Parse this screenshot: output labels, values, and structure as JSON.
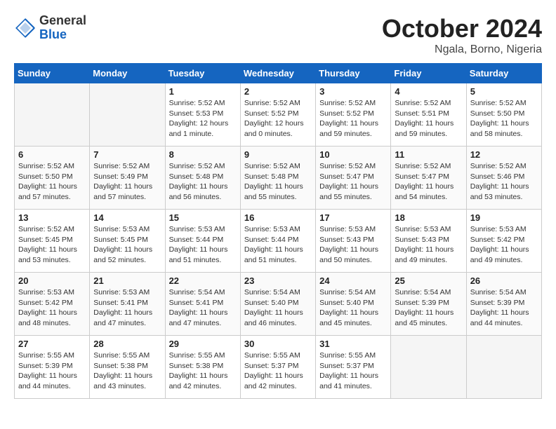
{
  "header": {
    "logo_general": "General",
    "logo_blue": "Blue",
    "month_title": "October 2024",
    "location": "Ngala, Borno, Nigeria"
  },
  "columns": [
    "Sunday",
    "Monday",
    "Tuesday",
    "Wednesday",
    "Thursday",
    "Friday",
    "Saturday"
  ],
  "weeks": [
    [
      {
        "day": "",
        "info": "",
        "empty": true
      },
      {
        "day": "",
        "info": "",
        "empty": true
      },
      {
        "day": "1",
        "info": "Sunrise: 5:52 AM\nSunset: 5:53 PM\nDaylight: 12 hours\nand 1 minute.",
        "empty": false
      },
      {
        "day": "2",
        "info": "Sunrise: 5:52 AM\nSunset: 5:52 PM\nDaylight: 12 hours\nand 0 minutes.",
        "empty": false
      },
      {
        "day": "3",
        "info": "Sunrise: 5:52 AM\nSunset: 5:52 PM\nDaylight: 11 hours\nand 59 minutes.",
        "empty": false
      },
      {
        "day": "4",
        "info": "Sunrise: 5:52 AM\nSunset: 5:51 PM\nDaylight: 11 hours\nand 59 minutes.",
        "empty": false
      },
      {
        "day": "5",
        "info": "Sunrise: 5:52 AM\nSunset: 5:50 PM\nDaylight: 11 hours\nand 58 minutes.",
        "empty": false
      }
    ],
    [
      {
        "day": "6",
        "info": "Sunrise: 5:52 AM\nSunset: 5:50 PM\nDaylight: 11 hours\nand 57 minutes.",
        "empty": false
      },
      {
        "day": "7",
        "info": "Sunrise: 5:52 AM\nSunset: 5:49 PM\nDaylight: 11 hours\nand 57 minutes.",
        "empty": false
      },
      {
        "day": "8",
        "info": "Sunrise: 5:52 AM\nSunset: 5:48 PM\nDaylight: 11 hours\nand 56 minutes.",
        "empty": false
      },
      {
        "day": "9",
        "info": "Sunrise: 5:52 AM\nSunset: 5:48 PM\nDaylight: 11 hours\nand 55 minutes.",
        "empty": false
      },
      {
        "day": "10",
        "info": "Sunrise: 5:52 AM\nSunset: 5:47 PM\nDaylight: 11 hours\nand 55 minutes.",
        "empty": false
      },
      {
        "day": "11",
        "info": "Sunrise: 5:52 AM\nSunset: 5:47 PM\nDaylight: 11 hours\nand 54 minutes.",
        "empty": false
      },
      {
        "day": "12",
        "info": "Sunrise: 5:52 AM\nSunset: 5:46 PM\nDaylight: 11 hours\nand 53 minutes.",
        "empty": false
      }
    ],
    [
      {
        "day": "13",
        "info": "Sunrise: 5:52 AM\nSunset: 5:45 PM\nDaylight: 11 hours\nand 53 minutes.",
        "empty": false
      },
      {
        "day": "14",
        "info": "Sunrise: 5:53 AM\nSunset: 5:45 PM\nDaylight: 11 hours\nand 52 minutes.",
        "empty": false
      },
      {
        "day": "15",
        "info": "Sunrise: 5:53 AM\nSunset: 5:44 PM\nDaylight: 11 hours\nand 51 minutes.",
        "empty": false
      },
      {
        "day": "16",
        "info": "Sunrise: 5:53 AM\nSunset: 5:44 PM\nDaylight: 11 hours\nand 51 minutes.",
        "empty": false
      },
      {
        "day": "17",
        "info": "Sunrise: 5:53 AM\nSunset: 5:43 PM\nDaylight: 11 hours\nand 50 minutes.",
        "empty": false
      },
      {
        "day": "18",
        "info": "Sunrise: 5:53 AM\nSunset: 5:43 PM\nDaylight: 11 hours\nand 49 minutes.",
        "empty": false
      },
      {
        "day": "19",
        "info": "Sunrise: 5:53 AM\nSunset: 5:42 PM\nDaylight: 11 hours\nand 49 minutes.",
        "empty": false
      }
    ],
    [
      {
        "day": "20",
        "info": "Sunrise: 5:53 AM\nSunset: 5:42 PM\nDaylight: 11 hours\nand 48 minutes.",
        "empty": false
      },
      {
        "day": "21",
        "info": "Sunrise: 5:53 AM\nSunset: 5:41 PM\nDaylight: 11 hours\nand 47 minutes.",
        "empty": false
      },
      {
        "day": "22",
        "info": "Sunrise: 5:54 AM\nSunset: 5:41 PM\nDaylight: 11 hours\nand 47 minutes.",
        "empty": false
      },
      {
        "day": "23",
        "info": "Sunrise: 5:54 AM\nSunset: 5:40 PM\nDaylight: 11 hours\nand 46 minutes.",
        "empty": false
      },
      {
        "day": "24",
        "info": "Sunrise: 5:54 AM\nSunset: 5:40 PM\nDaylight: 11 hours\nand 45 minutes.",
        "empty": false
      },
      {
        "day": "25",
        "info": "Sunrise: 5:54 AM\nSunset: 5:39 PM\nDaylight: 11 hours\nand 45 minutes.",
        "empty": false
      },
      {
        "day": "26",
        "info": "Sunrise: 5:54 AM\nSunset: 5:39 PM\nDaylight: 11 hours\nand 44 minutes.",
        "empty": false
      }
    ],
    [
      {
        "day": "27",
        "info": "Sunrise: 5:55 AM\nSunset: 5:39 PM\nDaylight: 11 hours\nand 44 minutes.",
        "empty": false
      },
      {
        "day": "28",
        "info": "Sunrise: 5:55 AM\nSunset: 5:38 PM\nDaylight: 11 hours\nand 43 minutes.",
        "empty": false
      },
      {
        "day": "29",
        "info": "Sunrise: 5:55 AM\nSunset: 5:38 PM\nDaylight: 11 hours\nand 42 minutes.",
        "empty": false
      },
      {
        "day": "30",
        "info": "Sunrise: 5:55 AM\nSunset: 5:37 PM\nDaylight: 11 hours\nand 42 minutes.",
        "empty": false
      },
      {
        "day": "31",
        "info": "Sunrise: 5:55 AM\nSunset: 5:37 PM\nDaylight: 11 hours\nand 41 minutes.",
        "empty": false
      },
      {
        "day": "",
        "info": "",
        "empty": true
      },
      {
        "day": "",
        "info": "",
        "empty": true
      }
    ]
  ]
}
